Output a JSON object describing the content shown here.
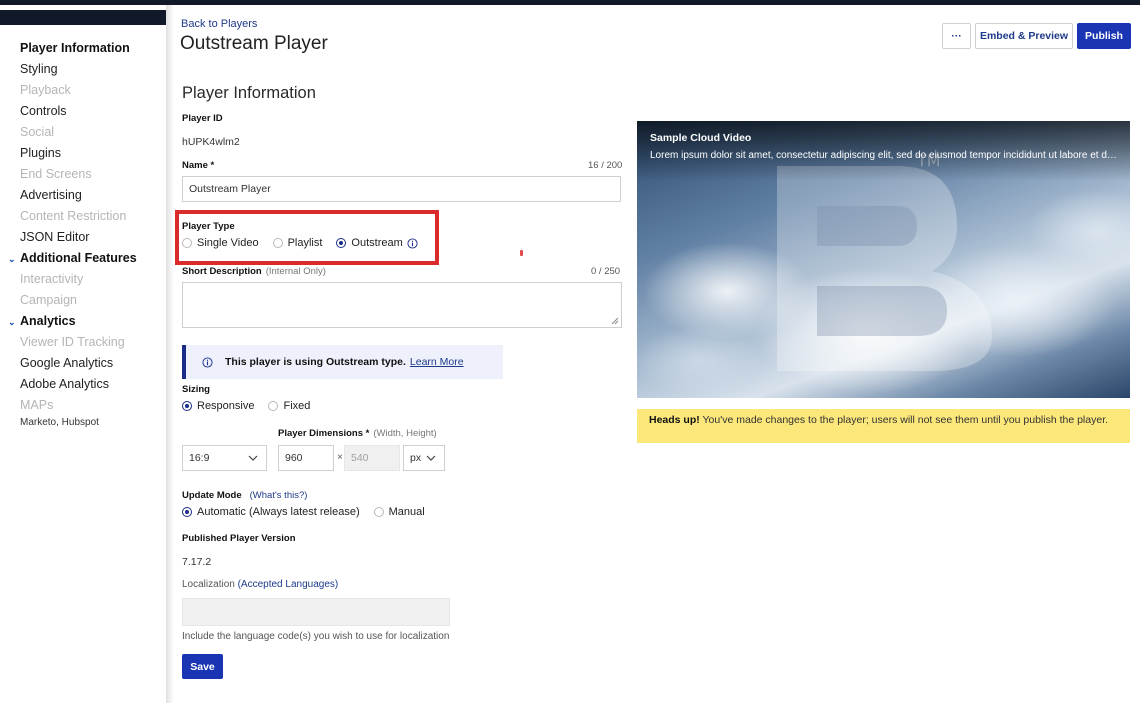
{
  "sidebar": {
    "items": [
      {
        "label": "Player Information",
        "state": "active"
      },
      {
        "label": "Styling",
        "state": "enabled"
      },
      {
        "label": "Playback",
        "state": "disabled"
      },
      {
        "label": "Controls",
        "state": "enabled"
      },
      {
        "label": "Social",
        "state": "disabled"
      },
      {
        "label": "Plugins",
        "state": "enabled"
      },
      {
        "label": "End Screens",
        "state": "disabled"
      },
      {
        "label": "Advertising",
        "state": "enabled"
      },
      {
        "label": "Content Restriction",
        "state": "disabled"
      },
      {
        "label": "JSON Editor",
        "state": "enabled"
      }
    ],
    "additional_features": {
      "label": "Additional Features",
      "items": [
        {
          "label": "Interactivity",
          "state": "disabled"
        },
        {
          "label": "Campaign",
          "state": "disabled"
        }
      ]
    },
    "analytics": {
      "label": "Analytics",
      "items": [
        {
          "label": "Viewer ID Tracking",
          "state": "disabled"
        },
        {
          "label": "Google Analytics",
          "state": "enabled"
        },
        {
          "label": "Adobe Analytics",
          "state": "enabled"
        },
        {
          "label": "MAPs",
          "state": "disabled"
        },
        {
          "label": "Marketo, Hubspot",
          "state": "small"
        }
      ]
    }
  },
  "header": {
    "back_link": "Back to Players",
    "title": "Outstream Player",
    "more_label": "···",
    "embed_label": "Embed & Preview",
    "publish_label": "Publish"
  },
  "form": {
    "section_title": "Player Information",
    "player_id_label": "Player ID",
    "player_id_value": "hUPK4wlm2",
    "name_label": "Name *",
    "name_counter": "16 / 200",
    "name_value": "Outstream Player",
    "player_type_label": "Player Type",
    "player_type_options": [
      "Single Video",
      "Playlist",
      "Outstream"
    ],
    "player_type_selected": "Outstream",
    "short_desc_label": "Short Description",
    "short_desc_sub": "(Internal Only)",
    "short_desc_counter": "0 / 250",
    "info_banner_text": "This player is using Outstream type.",
    "info_banner_link": "Learn More",
    "sizing_label": "Sizing",
    "sizing_options": [
      "Responsive",
      "Fixed"
    ],
    "sizing_selected": "Responsive",
    "aspect_ratio": "16:9",
    "dimensions_label": "Player Dimensions *",
    "dimensions_sub": "(Width, Height)",
    "width_value": "960",
    "times": "×",
    "height_value": "540",
    "unit": "px",
    "update_mode_label": "Update Mode",
    "update_mode_link": "(What's this?)",
    "update_mode_options": [
      "Automatic (Always latest release)",
      "Manual"
    ],
    "update_mode_selected": "Automatic (Always latest release)",
    "version_label": "Published Player Version",
    "version_value": "7.17.2",
    "localization_label": "Localization",
    "localization_link": "(Accepted Languages)",
    "localization_help": "Include the language code(s) you wish to use for localization",
    "save_label": "Save"
  },
  "preview": {
    "video_title": "Sample Cloud Video",
    "video_desc": "Lorem ipsum dolor sit amet, consectetur adipiscing elit, sed do eiusmod tempor incididunt ut labore et dolore magna aliqua.",
    "heads_up_bold": "Heads up!",
    "heads_up_text": "You've made changes to the player; users will not see them until you publish the player."
  },
  "colors": {
    "accent": "#1a35b3",
    "highlight": "#d92b2b",
    "warning_bg": "#fbe77a"
  }
}
